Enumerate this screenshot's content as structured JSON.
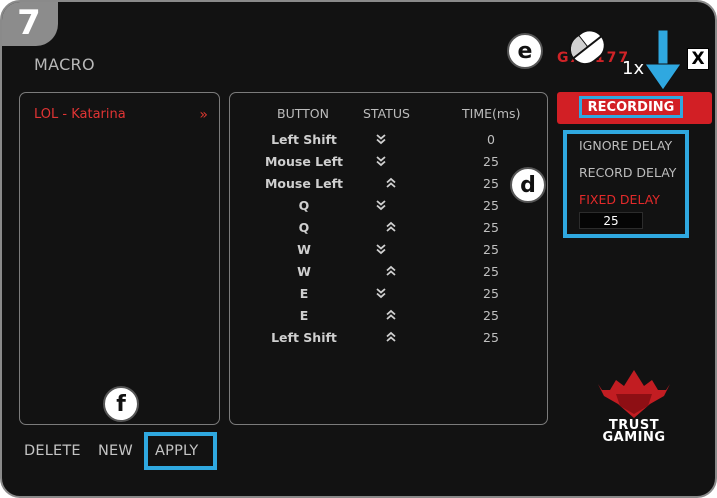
{
  "page_tab": {
    "number": "7"
  },
  "title": "MACRO",
  "macro_list": {
    "items": [
      {
        "name": "LOL - Katarina",
        "arrows": "»"
      }
    ]
  },
  "table": {
    "headers": {
      "button": "BUTTON",
      "status": "STATUS",
      "time": "TIME(ms)"
    },
    "rows": [
      {
        "button": "Left Shift",
        "status": "down",
        "time": "0"
      },
      {
        "button": "Mouse Left",
        "status": "down",
        "time": "25"
      },
      {
        "button": "Mouse Left",
        "status": "up",
        "time": "25"
      },
      {
        "button": "Q",
        "status": "down",
        "time": "25"
      },
      {
        "button": "Q",
        "status": "up",
        "time": "25"
      },
      {
        "button": "W",
        "status": "down",
        "time": "25"
      },
      {
        "button": "W",
        "status": "up",
        "time": "25"
      },
      {
        "button": "E",
        "status": "down",
        "time": "25"
      },
      {
        "button": "E",
        "status": "up",
        "time": "25"
      },
      {
        "button": "Left Shift",
        "status": "up",
        "time": "25"
      }
    ]
  },
  "recording": {
    "label": "RECORDING"
  },
  "delay": {
    "ignore": "IGNORE DELAY",
    "record": "RECORD DELAY",
    "fixed": "FIXED DELAY",
    "fixed_value": "25",
    "selected": "fixed"
  },
  "badges": {
    "e": "e",
    "d": "d",
    "f": "f"
  },
  "brand": "GXT177",
  "click_hint": "1x",
  "close_label": "X",
  "bottom": {
    "delete": "DELETE",
    "new": "NEW",
    "apply": "APPLY"
  },
  "logo": {
    "line1": "TRUST",
    "line2": "GAMING"
  },
  "colors": {
    "accent_red": "#d21f25",
    "highlight_blue": "#2fa8e0",
    "background": "#121212"
  },
  "icons": {
    "status_down": "double-chevron-down-icon",
    "status_up": "double-chevron-up-icon",
    "mouse": "mouse-icon",
    "arrow": "arrow-down-icon"
  }
}
